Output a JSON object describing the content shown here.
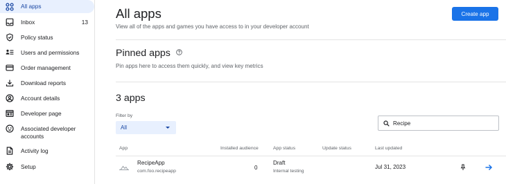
{
  "sidebar": {
    "items": [
      {
        "label": "All apps",
        "icon": "apps-grid-icon",
        "active": true
      },
      {
        "label": "Inbox",
        "icon": "inbox-icon",
        "count": "13"
      },
      {
        "label": "Policy status",
        "icon": "shield-icon"
      },
      {
        "label": "Users and permissions",
        "icon": "users-list-icon"
      },
      {
        "label": "Order management",
        "icon": "credit-card-icon"
      },
      {
        "label": "Download reports",
        "icon": "download-icon"
      },
      {
        "label": "Account details",
        "icon": "account-circle-icon"
      },
      {
        "label": "Developer page",
        "icon": "web-page-icon"
      },
      {
        "label": "Associated developer accounts",
        "icon": "associated-accounts-icon"
      },
      {
        "label": "Activity log",
        "icon": "document-icon"
      },
      {
        "label": "Setup",
        "icon": "gear-icon"
      }
    ]
  },
  "header": {
    "title": "All apps",
    "subtitle": "View all of the apps and games you have access to in your developer account",
    "create_button": "Create app"
  },
  "pinned": {
    "title": "Pinned apps",
    "subtitle": "Pin apps here to access them quickly, and view key metrics"
  },
  "apps_section": {
    "title": "3 apps",
    "filter_label": "Filter by",
    "filter_value": "All",
    "search_value": "Recipe"
  },
  "table": {
    "columns": [
      "App",
      "Installed audience",
      "App status",
      "Update status",
      "Last updated"
    ],
    "rows": [
      {
        "name": "RecipeApp",
        "package": "com.foo.recipeapp",
        "installs": "0",
        "status": "Draft",
        "status_detail": "Internal testing",
        "update_status": "",
        "last_updated": "Jul 31, 2023"
      }
    ]
  },
  "colors": {
    "accent": "#1a73e8",
    "active_bg": "#e8f0fe",
    "active_text": "#1a47a3"
  }
}
